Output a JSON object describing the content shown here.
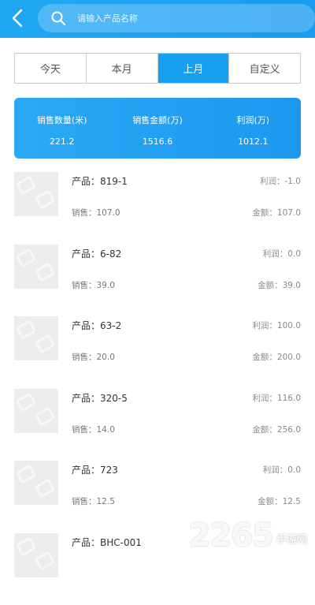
{
  "header": {
    "search_placeholder": "请输入产品名称"
  },
  "tabs": [
    {
      "label": "今天",
      "active": false
    },
    {
      "label": "本月",
      "active": false
    },
    {
      "label": "上月",
      "active": true
    },
    {
      "label": "自定义",
      "active": false
    }
  ],
  "stats": [
    {
      "label": "销售数量(米)",
      "value": "221.2"
    },
    {
      "label": "销售金额(万)",
      "value": "1516.6"
    },
    {
      "label": "利润(万)",
      "value": "1012.1"
    }
  ],
  "products": [
    {
      "name": "产品：819-1",
      "sales": "销售：107.0",
      "profit": "利润：-1.0",
      "amount": "金额：107.0"
    },
    {
      "name": "产品：6-82",
      "sales": "销售：39.0",
      "profit": "利润：0.0",
      "amount": "金额：39.0"
    },
    {
      "name": "产品：63-2",
      "sales": "销售：20.0",
      "profit": "利润：100.0",
      "amount": "金额：200.0"
    },
    {
      "name": "产品：320-5",
      "sales": "销售：14.0",
      "profit": "利润：116.0",
      "amount": "金额：256.0"
    },
    {
      "name": "产品：723",
      "sales": "销售：12.5",
      "profit": "利润：0.0",
      "amount": "金额：12.5"
    },
    {
      "name": "产品：BHC-001",
      "sales": "",
      "profit": "",
      "amount": ""
    }
  ],
  "watermark": {
    "number": "2265",
    "site": "手游网"
  },
  "colors": {
    "accent": "#1a9cf0",
    "active_tab": "#16a0f0"
  }
}
